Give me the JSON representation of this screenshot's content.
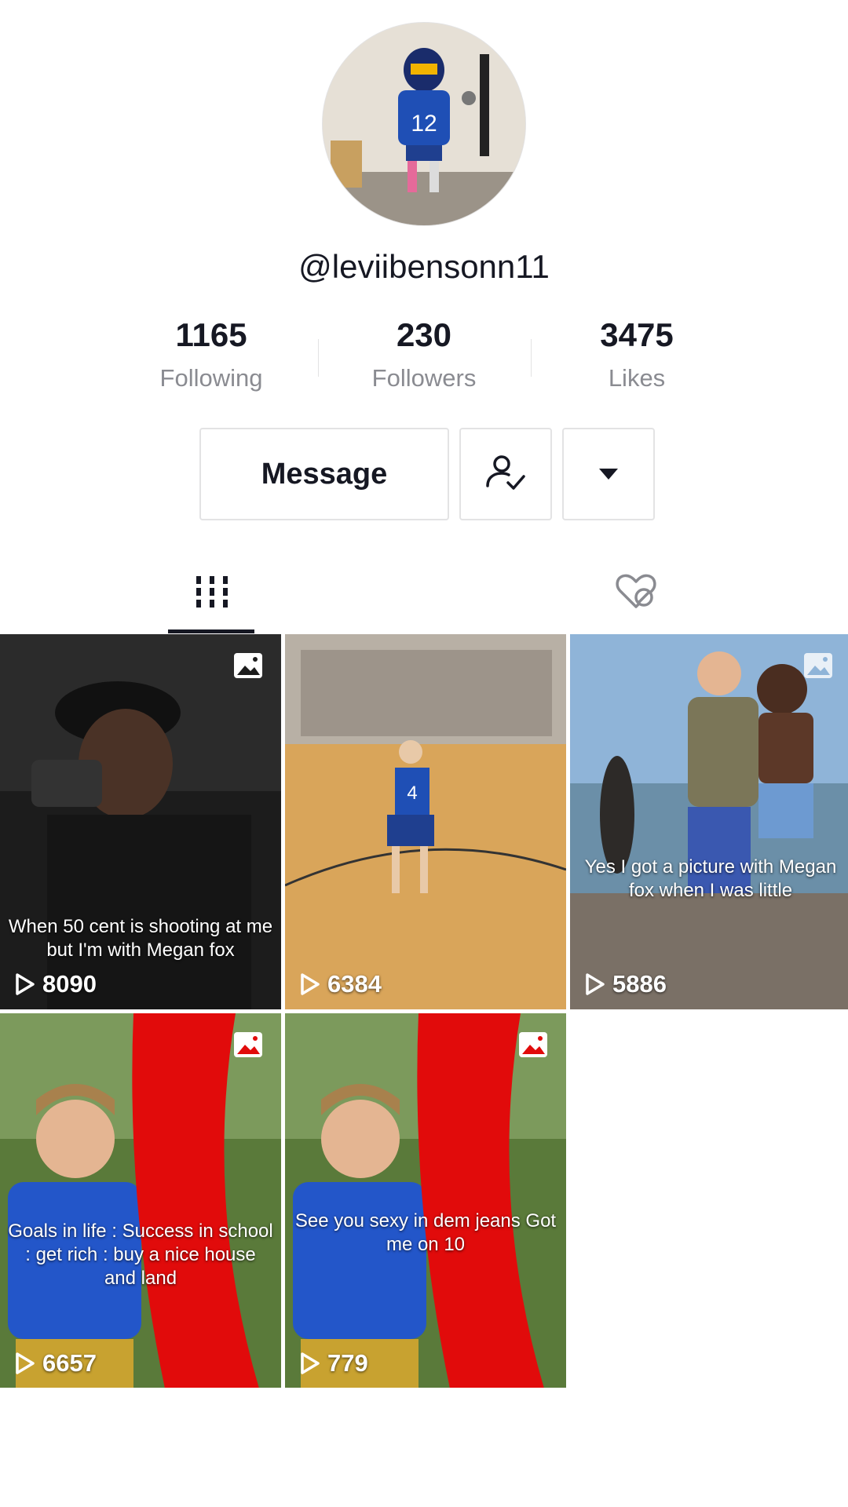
{
  "profile": {
    "username": "@leviibensonn11"
  },
  "stats": [
    {
      "value": "1165",
      "label": "Following"
    },
    {
      "value": "230",
      "label": "Followers"
    },
    {
      "value": "3475",
      "label": "Likes"
    }
  ],
  "actions": {
    "message_label": "Message"
  },
  "videos": [
    {
      "caption": "When 50 cent is shooting at me but I'm with Megan fox",
      "views": "8090"
    },
    {
      "caption": "",
      "views": "6384"
    },
    {
      "caption": "Yes I got a picture with Megan fox when I was little",
      "views": "5886"
    },
    {
      "caption": "Goals in life : Success in school : get rich : buy a nice house and land",
      "views": "6657"
    },
    {
      "caption": "See you sexy in dem jeans Got me on 10",
      "views": "779"
    }
  ],
  "colors": {
    "text": "#161823",
    "muted": "#8a8b91",
    "border": "#e3e3e4"
  }
}
